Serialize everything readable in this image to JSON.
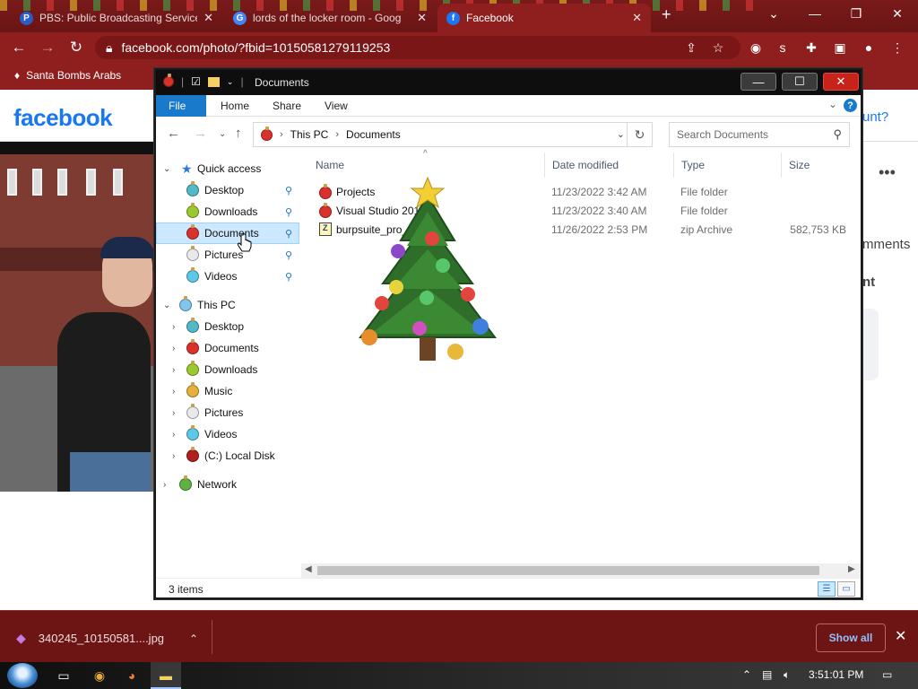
{
  "browser": {
    "tabs": [
      {
        "title": "PBS: Public Broadcasting Service",
        "favicon_color": "#2a5cc7",
        "favicon": "P"
      },
      {
        "title": "lords of the locker room - Goog",
        "favicon_color": "#4285f4",
        "favicon": "G"
      },
      {
        "title": "Facebook",
        "favicon_color": "#1877f2",
        "favicon": "f"
      }
    ],
    "new_tab": "+",
    "url": "facebook.com/photo/?fbid=10150581279119253",
    "bookmark": "Santa Bombs Arabs",
    "extension_badge": "s"
  },
  "facebook": {
    "logo": "facebook",
    "side_texts": [
      "unt?",
      "mments",
      "nt",
      "…"
    ]
  },
  "explorer": {
    "title": "Documents",
    "ribbon_tabs": [
      "File",
      "Home",
      "Share",
      "View"
    ],
    "breadcrumb": [
      "This PC",
      "Documents"
    ],
    "search_placeholder": "Search Documents",
    "columns": [
      "Name",
      "Date modified",
      "Type",
      "Size"
    ],
    "tree": {
      "quick_access": "Quick access",
      "quick_items": [
        "Desktop",
        "Downloads",
        "Documents",
        "Pictures",
        "Videos"
      ],
      "this_pc": "This PC",
      "pc_items": [
        "Desktop",
        "Documents",
        "Downloads",
        "Music",
        "Pictures",
        "Videos",
        "(C:) Local Disk"
      ],
      "network": "Network"
    },
    "files": [
      {
        "name": "Projects",
        "date": "11/23/2022 3:42 AM",
        "type": "File folder",
        "size": ""
      },
      {
        "name": "Visual Studio 2010",
        "date": "11/23/2022 3:40 AM",
        "type": "File folder",
        "size": ""
      },
      {
        "name": "burpsuite_pro_",
        "date": "11/26/2022 2:53 PM",
        "type": "zip Archive",
        "size": "582,753 KB"
      }
    ],
    "status": "3 items"
  },
  "downloads": {
    "file": "340245_10150581....jpg",
    "show_all": "Show all"
  },
  "taskbar": {
    "time": "3:51:01 PM"
  },
  "colors": {
    "chrome_frame": "#8f1e1e",
    "explorer_accent": "#1979ca",
    "selection": "#cce8ff",
    "facebook_blue": "#1877f2"
  }
}
